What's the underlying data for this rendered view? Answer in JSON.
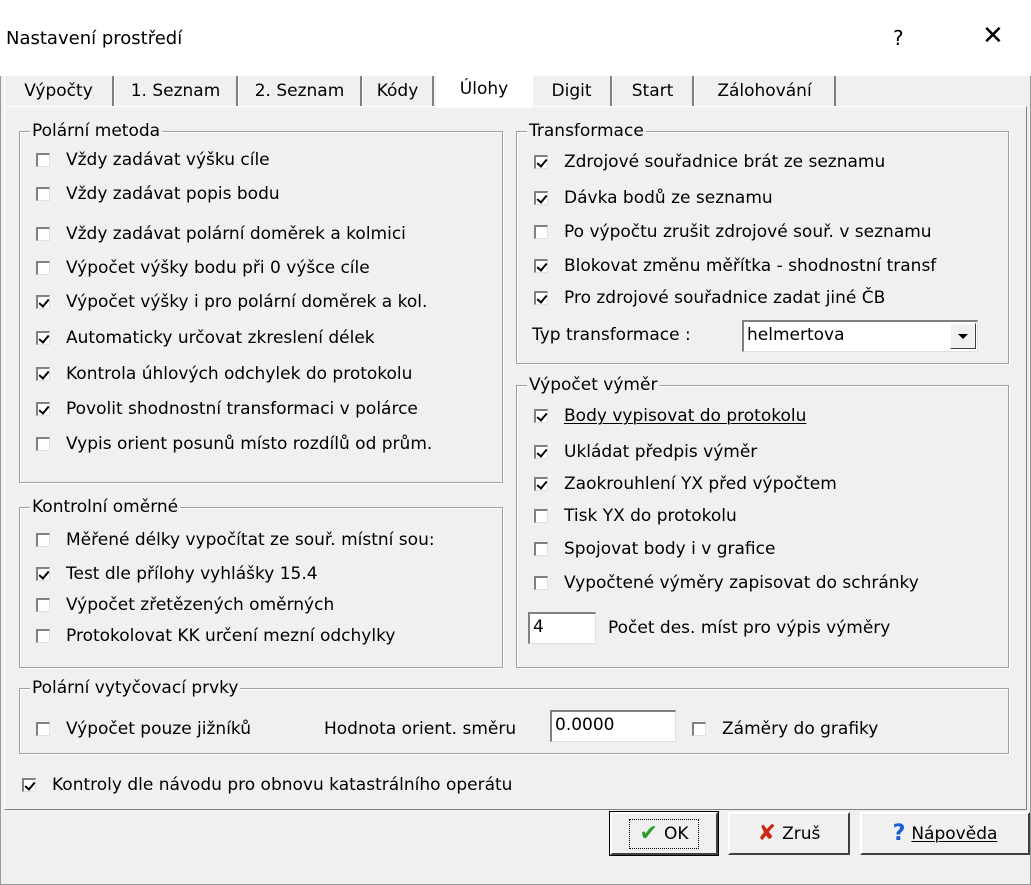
{
  "window": {
    "title": "Nastavení prostředí",
    "help": "?",
    "close": "✕"
  },
  "tabs": [
    {
      "label": "Výpočty"
    },
    {
      "label": "1. Seznam"
    },
    {
      "label": "2. Seznam"
    },
    {
      "label": "Kódy"
    },
    {
      "label": "Úlohy"
    },
    {
      "label": "Digit"
    },
    {
      "label": "Start"
    },
    {
      "label": "Zálohování"
    }
  ],
  "active_tab": "Úlohy",
  "polar": {
    "title": "Polární metoda",
    "items": [
      {
        "label": "Vždy zadávat výšku cíle",
        "checked": false
      },
      {
        "label": "Vždy zadávat popis bodu",
        "checked": false
      },
      {
        "label": "Vždy zadávat polární doměrek a kolmici",
        "checked": false
      },
      {
        "label": "Výpočet výšky bodu při 0 výšce cíle",
        "checked": false
      },
      {
        "label": "Výpočet výšky i pro polární doměrek a kol.",
        "checked": true
      },
      {
        "label": "Automaticky určovat zkreslení délek",
        "checked": true
      },
      {
        "label": "Kontrola úhlových odchylek do protokolu",
        "checked": true
      },
      {
        "label": "Povolit shodnostní transformaci v polárce",
        "checked": true
      },
      {
        "label": "Vypis orient posunů místo rozdílů od prům.",
        "checked": false
      }
    ]
  },
  "control": {
    "title": "Kontrolní oměrné",
    "items": [
      {
        "label": "Měřené délky vypočítat ze souř. místní sou:",
        "checked": false
      },
      {
        "label": "Test dle přílohy vyhlášky 15.4",
        "checked": true
      },
      {
        "label": "Výpočet zřetězených oměrných",
        "checked": false
      },
      {
        "label": "Protokolovat KK určení mezní odchylky",
        "checked": false
      }
    ]
  },
  "transform": {
    "title": "Transformace",
    "items": [
      {
        "label": "Zdrojové souřadnice brát ze seznamu",
        "checked": true
      },
      {
        "label": "Dávka bodů ze seznamu",
        "checked": true
      },
      {
        "label": "Po výpočtu zrušit zdrojové souř. v seznamu",
        "checked": false
      },
      {
        "label": "Blokovat změnu měřítka - shodnostní transf",
        "checked": true
      },
      {
        "label": "Pro zdrojové souřadnice zadat jiné ČB",
        "checked": true
      }
    ],
    "type_label": "Typ transformace :",
    "type_value": "helmertova"
  },
  "area": {
    "title": "Výpočet výměr",
    "items": [
      {
        "label": "Body vypisovat do protokolu",
        "checked": true
      },
      {
        "label": "Ukládat předpis výměr",
        "checked": true
      },
      {
        "label": "Zaokrouhlení YX před výpočtem",
        "checked": true
      },
      {
        "label": "Tisk YX do protokolu",
        "checked": false
      },
      {
        "label": "Spojovat body i v grafice",
        "checked": false
      },
      {
        "label": "Vypočtené výměry zapisovat do schránky",
        "checked": false
      }
    ],
    "decimals_value": "4",
    "decimals_label": "Počet des. míst pro výpis výměry"
  },
  "stakeout": {
    "title": "Polární vytyčovací prvky",
    "south_label": "Výpočet pouze jižníků",
    "south_checked": false,
    "orient_label": "Hodnota orient. směru",
    "orient_value": "0.0000",
    "graphics_label": "Záměry do grafiky",
    "graphics_checked": false
  },
  "cadastre": {
    "label": "Kontroly dle návodu pro obnovu katastrálního operátu",
    "checked": true
  },
  "buttons": {
    "ok": "OK",
    "cancel": "Zruš",
    "help": "Nápověda"
  },
  "icons": {
    "ok": "check-icon",
    "cancel": "cross-icon",
    "help": "question-icon"
  },
  "colors": {
    "ok_icon": "#2a9d2a",
    "cancel_icon": "#cc2a14",
    "help_icon": "#1a5bd6"
  }
}
